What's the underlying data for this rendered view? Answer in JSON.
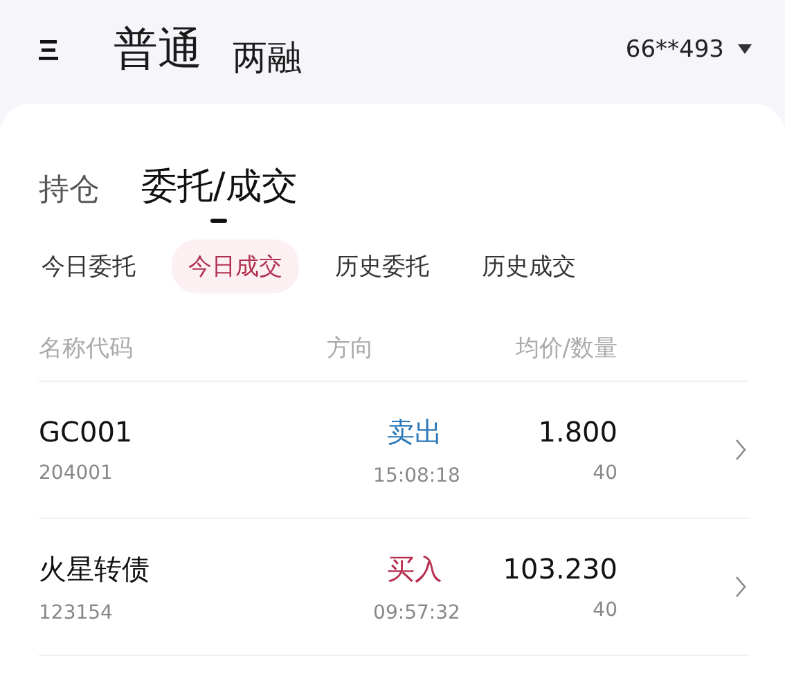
{
  "header": {
    "account_types": [
      {
        "label": "普通",
        "selected": true
      },
      {
        "label": "两融",
        "selected": false
      }
    ],
    "account": "66**493"
  },
  "main_tabs": [
    {
      "label": "持仓",
      "selected": false
    },
    {
      "label": "委托/成交",
      "selected": true
    }
  ],
  "sub_tabs": [
    {
      "label": "今日委托",
      "selected": false
    },
    {
      "label": "今日成交",
      "selected": true
    },
    {
      "label": "历史委托",
      "selected": false
    },
    {
      "label": "历史成交",
      "selected": false
    }
  ],
  "table": {
    "columns": [
      "名称代码",
      "方向",
      "均价/数量"
    ],
    "rows": [
      {
        "name": "GC001",
        "code": "204001",
        "direction": "卖出",
        "kind": "sell",
        "time": "15:08:18",
        "price": "1.800",
        "quantity": "40"
      },
      {
        "name": "火星转债",
        "code": "123154",
        "direction": "买入",
        "kind": "buy",
        "time": "09:57:32",
        "price": "103.230",
        "quantity": "40"
      }
    ]
  }
}
